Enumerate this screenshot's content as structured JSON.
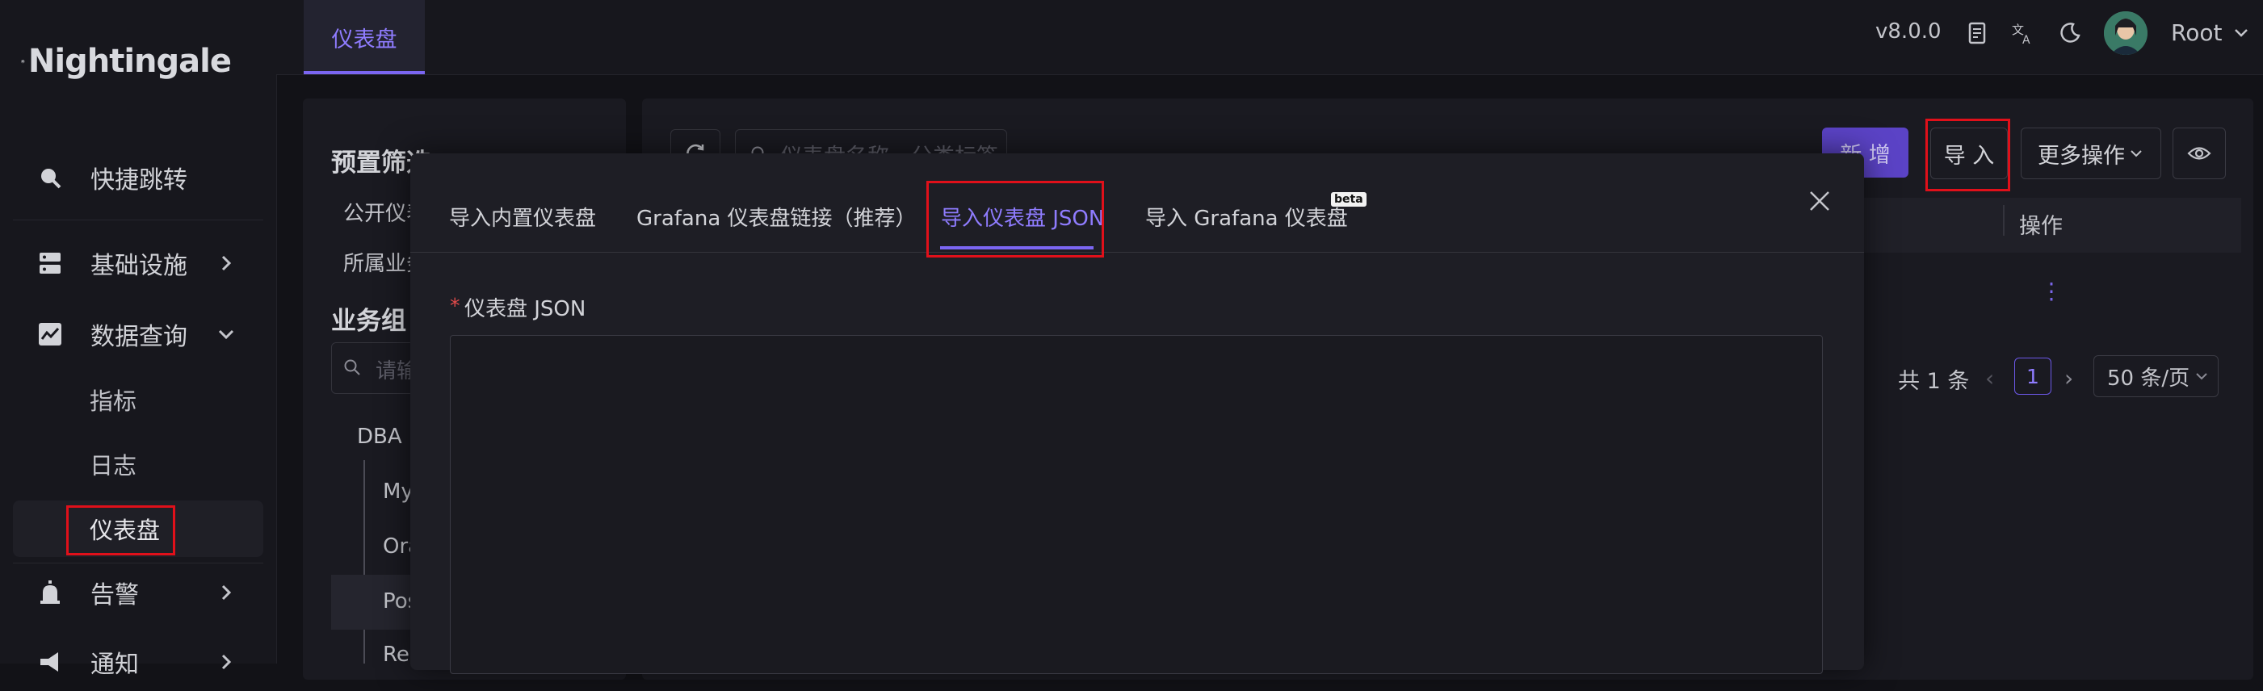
{
  "app": {
    "name": "Nightingale",
    "version": "v8.0.0",
    "user": "Root"
  },
  "header": {
    "active_tab": "仪表盘"
  },
  "sidebar": {
    "items": [
      {
        "label": "快捷跳转",
        "icon": "search-icon"
      },
      {
        "label": "基础设施",
        "icon": "server-icon"
      },
      {
        "label": "数据查询",
        "icon": "chart-icon"
      },
      {
        "label": "告警",
        "icon": "alarm-icon"
      },
      {
        "label": "通知",
        "icon": "megaphone-icon"
      }
    ],
    "sub_items": [
      "指标",
      "日志",
      "仪表盘"
    ]
  },
  "left_panel": {
    "preset_filter": "预置筛选",
    "public": "公开仪表",
    "belonging": "所属业务",
    "business_group": "业务组",
    "search_placeholder": "请输",
    "tree": [
      "DBA",
      "My",
      "Ora",
      "Pos",
      "Red"
    ]
  },
  "toolbar": {
    "search_placeholder": "仪表盘名称、分类标签",
    "new_label": "新 增",
    "import_label": "导 入",
    "more_label": "更多操作"
  },
  "table": {
    "col_action": "操作",
    "row_menu": "⋮"
  },
  "pager": {
    "total": "共 1 条",
    "page": "1",
    "size": "50 条/页"
  },
  "modal": {
    "tabs": [
      "导入内置仪表盘",
      "Grafana 仪表盘链接（推荐）",
      "导入仪表盘 JSON",
      "导入 Grafana 仪表盘"
    ],
    "beta": "beta",
    "active_tab_index": 2,
    "field_label": "仪表盘 JSON",
    "required_mark": "*",
    "json_value": ""
  },
  "colors": {
    "accent": "#7b66f2",
    "highlight": "#e0101a",
    "bg": "#121217"
  }
}
